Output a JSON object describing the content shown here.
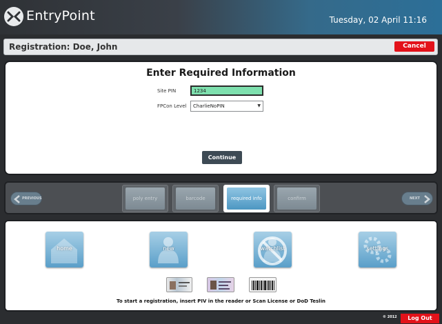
{
  "header": {
    "brand": "EntryPoint",
    "datetime": "Tuesday, 02 April 11:16",
    "background_color": "#2c6f98"
  },
  "registration": {
    "title": "Registration: Doe, John",
    "cancel_label": "Cancel"
  },
  "form": {
    "heading": "Enter Required Information",
    "site_pin_label": "Site PIN",
    "site_pin_value": "1234",
    "fpcon_label": "FPCon Level",
    "fpcon_value": "CharlieNoPIN",
    "continue_label": "Continue"
  },
  "nav": {
    "previous_label": "PREVIOUS",
    "next_label": "NEXT",
    "steps": [
      {
        "label": "poly entry",
        "active": false
      },
      {
        "label": "barcode",
        "active": false
      },
      {
        "label": "required info",
        "active": true
      },
      {
        "label": "confirm",
        "active": false
      }
    ]
  },
  "apps": {
    "home_label": "home",
    "new_label": "new",
    "watchlist_label": "watchlist",
    "settings_label": "settings"
  },
  "instruction": "To start a registration, insert PIV in the reader or Scan License or DoD Teslin",
  "footer": {
    "copyright": "© 2012",
    "logout_label": "Log Out"
  },
  "colors": {
    "accent_red": "#e3121a",
    "pin_green": "#7ee0ae",
    "continue_dark": "#3d4a54"
  }
}
